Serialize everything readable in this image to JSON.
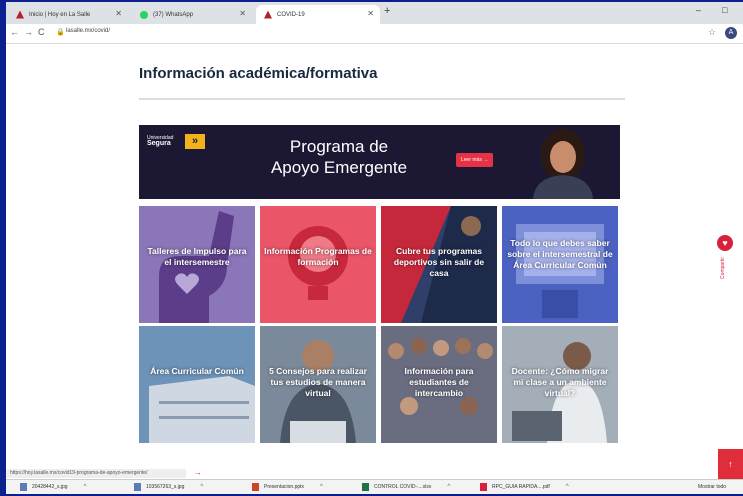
{
  "tabs": [
    {
      "label": "Inicio | Hoy en La Salle",
      "color": "#b3202f"
    },
    {
      "label": "(37) WhatsApp",
      "color": "#25d366"
    },
    {
      "label": "COVID-19",
      "color": "#b3202f"
    }
  ],
  "window": {
    "minimize": "–",
    "maximize": "□"
  },
  "address_bar": {
    "url": "lasalle.mx/covid/",
    "back": "←",
    "forward": "→",
    "reload": "C",
    "account_initial": "A"
  },
  "page": {
    "section_title": "Información académica/formativa",
    "banner": {
      "logo_line1": "Universidad",
      "logo_line2": "Segura",
      "headline_line1": "Programa de",
      "headline_line2": "Apoyo Emergente",
      "cta": "Leer más →"
    },
    "tiles": [
      {
        "caption": "Talleres de Impulso para el intersemestre",
        "color": "#8a76b8"
      },
      {
        "caption": "Información Programas de formación",
        "color": "#ea5568"
      },
      {
        "caption": "Cubre tus programas deportivos sin salir de casa",
        "color": "#2f3f6a"
      },
      {
        "caption": "Todo lo que debes saber sobre el intersemestral de Área Curricular Común",
        "color": "#4c62c2"
      },
      {
        "caption": "Área Curricular Común",
        "color": "#4a6f95"
      },
      {
        "caption": "5 Consejos para realizar tus estudios de manera virtual",
        "color": "#6b7a8c"
      },
      {
        "caption": "Información para estudiantes de intercambio",
        "color": "#5b5e72"
      },
      {
        "caption": "Docente: ¿Cómo migrar mi clase a un ambiente virtual?",
        "color": "#8b97a5"
      }
    ],
    "share_label": "Compartir",
    "scroll_top": "↑"
  },
  "status_bar": {
    "link": "https://hoy.lasalle.mx/covid19-programa-de-apoyo-emergente/"
  },
  "downloads": [
    {
      "name": "20428442_s.jpg",
      "color": "#5b7bb8"
    },
    {
      "name": "103567263_s.jpg",
      "color": "#5b7bb8"
    },
    {
      "name": "Presentacion.pptx",
      "color": "#d04423"
    },
    {
      "name": "CONTROL COVID-....xlsx",
      "color": "#1f7244"
    },
    {
      "name": "RPC_GUIA RAPIDA....pdf",
      "color": "#d8203a"
    }
  ],
  "downloads_show_all": "Mostrar todo"
}
